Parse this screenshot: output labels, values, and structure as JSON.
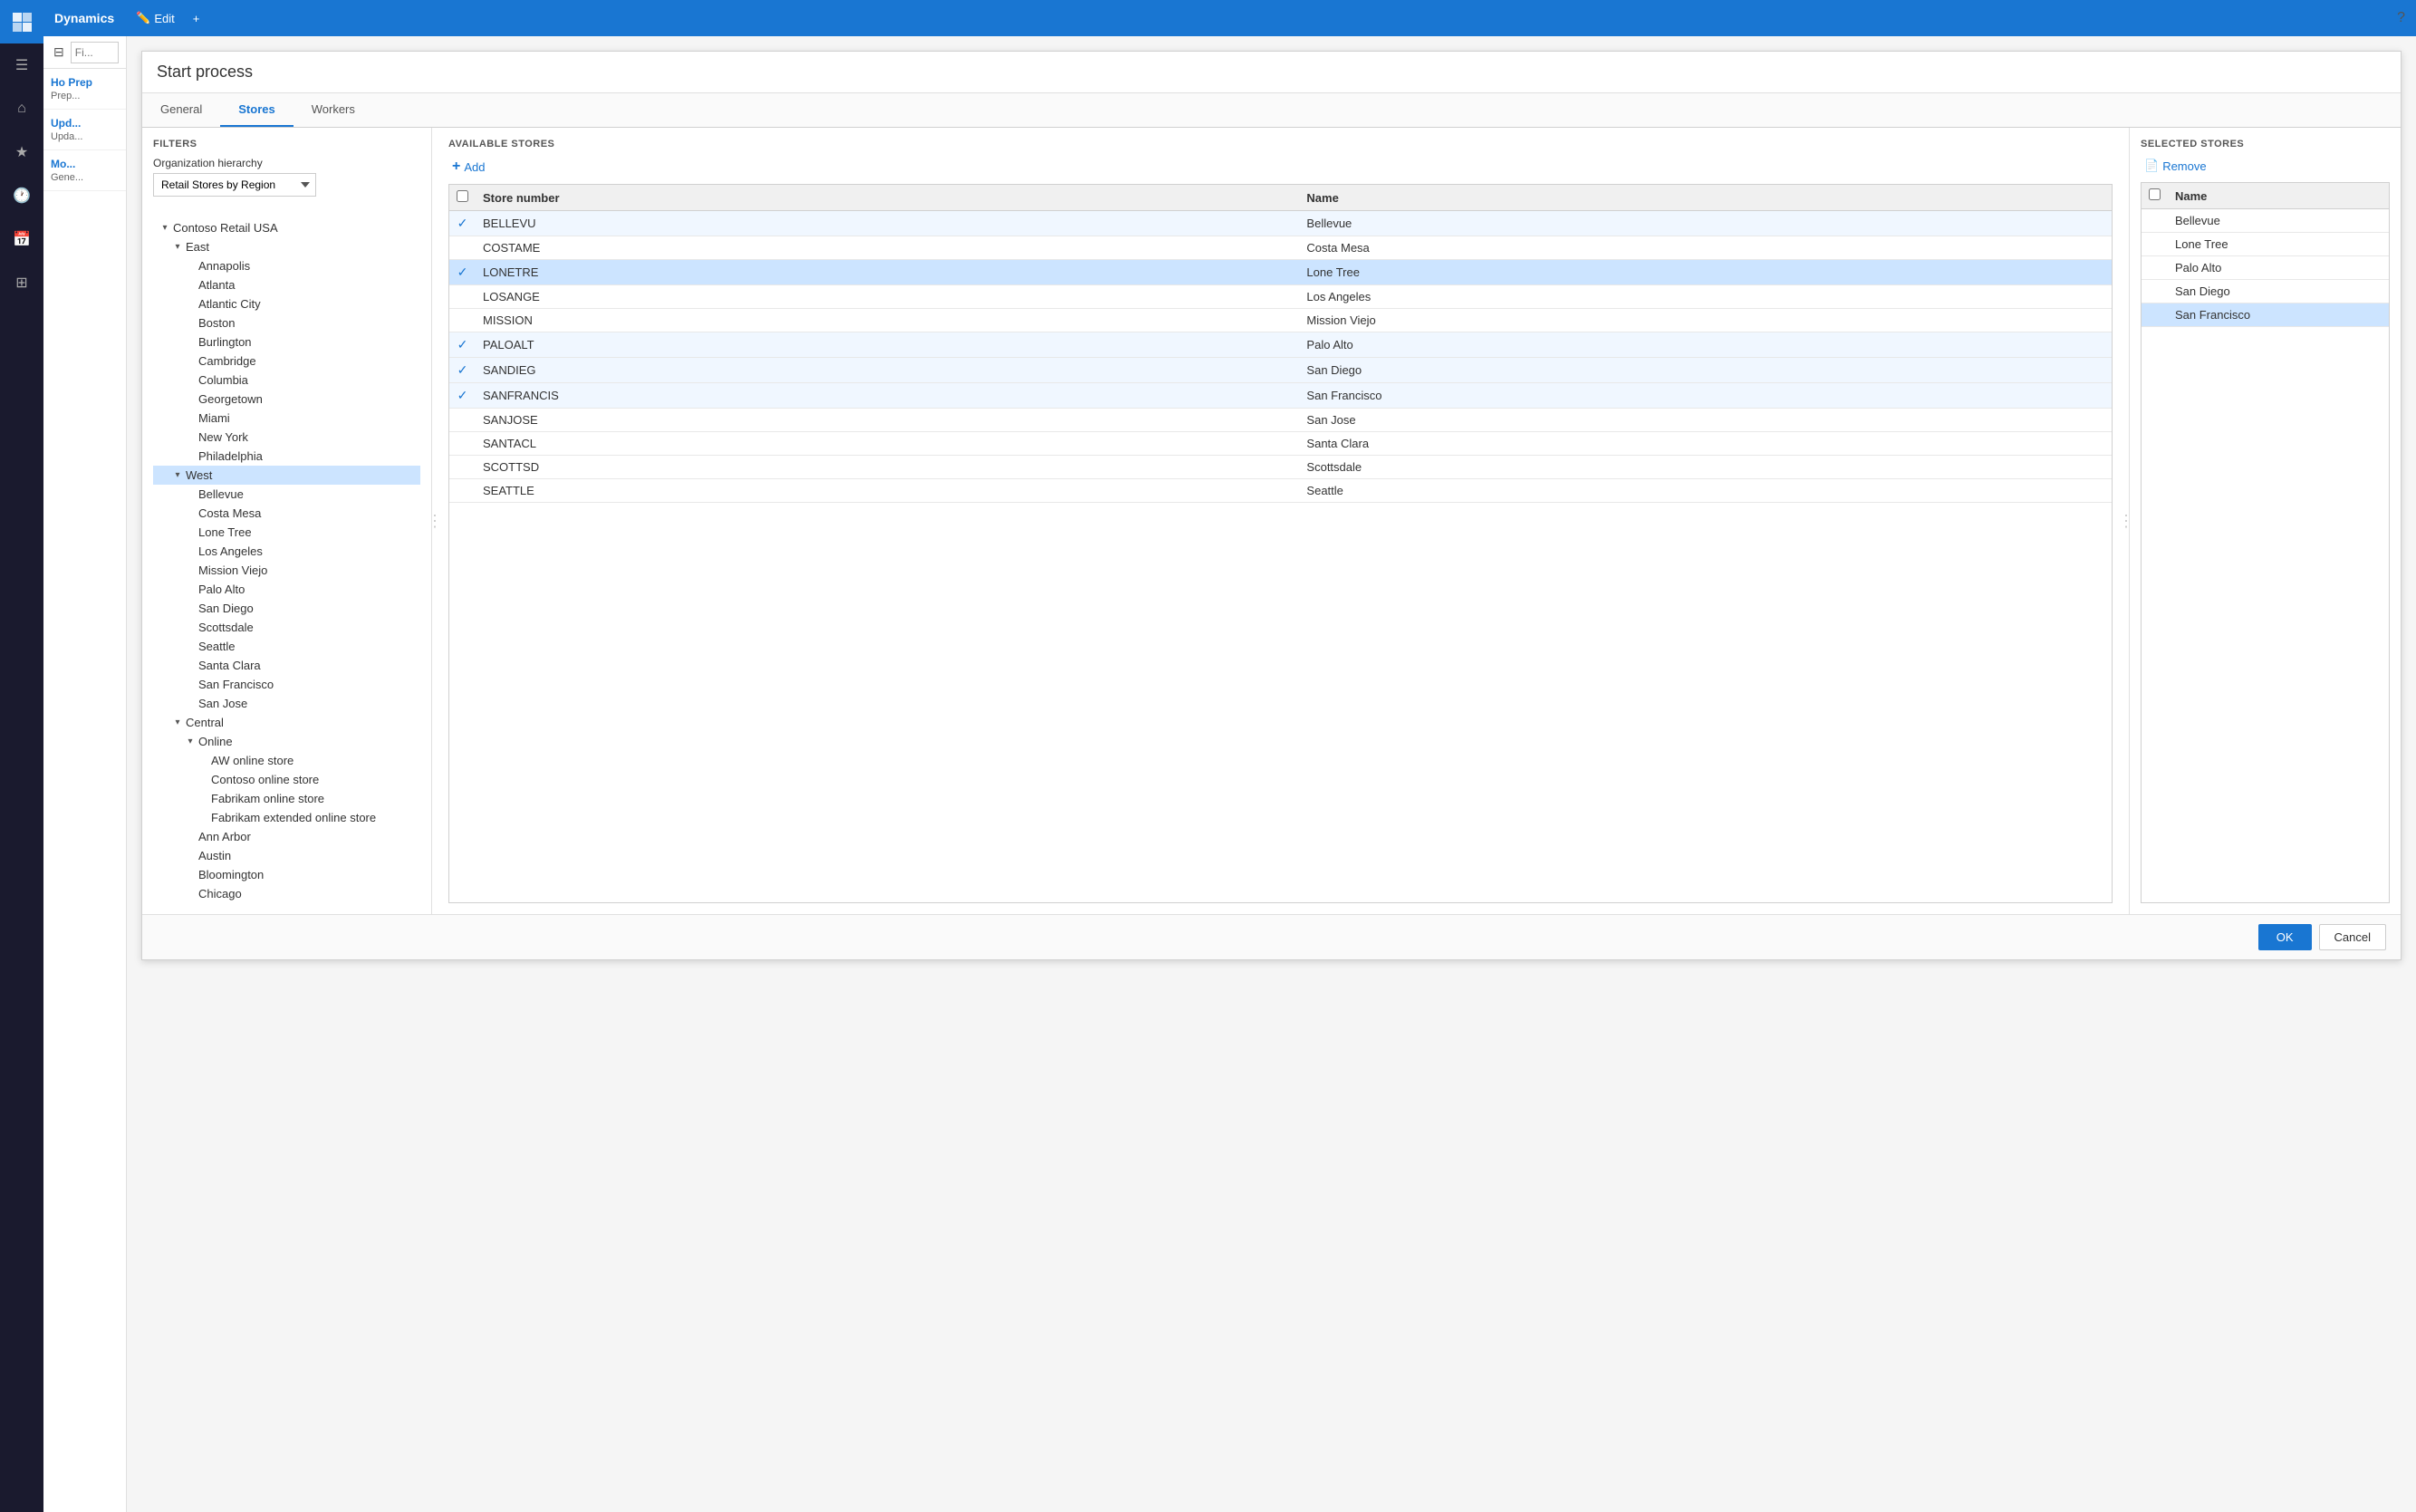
{
  "app": {
    "brand": "Dynamics",
    "help_icon": "?"
  },
  "topbar": {
    "edit_label": "Edit",
    "add_icon": "+",
    "nav_icons": [
      "☰",
      "⌂",
      "★",
      "🕐",
      "📅",
      "≡"
    ]
  },
  "left_panel": {
    "items": [
      {
        "title": "Ho Prep",
        "sub": "Prep..."
      },
      {
        "title": "Upd...",
        "sub": "Upda..."
      },
      {
        "title": "Mo...",
        "sub": "Gene..."
      }
    ]
  },
  "dialog": {
    "title": "Start process",
    "tabs": [
      {
        "label": "General",
        "active": false
      },
      {
        "label": "Stores",
        "active": true
      },
      {
        "label": "Workers",
        "active": false
      }
    ],
    "filters": {
      "section_title": "FILTERS",
      "org_hierarchy_label": "Organization hierarchy",
      "dropdown_value": "Retail Stores by Region",
      "dropdown_options": [
        "Retail Stores by Region"
      ],
      "tree": [
        {
          "id": "contoso",
          "label": "Contoso Retail USA",
          "indent": 0,
          "expandable": true,
          "expanded": true,
          "bold": false
        },
        {
          "id": "east",
          "label": "East",
          "indent": 1,
          "expandable": true,
          "expanded": true,
          "bold": false
        },
        {
          "id": "annapolis",
          "label": "Annapolis",
          "indent": 2,
          "expandable": false,
          "expanded": false,
          "bold": false
        },
        {
          "id": "atlanta",
          "label": "Atlanta",
          "indent": 2,
          "expandable": false,
          "expanded": false,
          "bold": false
        },
        {
          "id": "atlantic-city",
          "label": "Atlantic City",
          "indent": 2,
          "expandable": false,
          "expanded": false,
          "bold": false
        },
        {
          "id": "boston",
          "label": "Boston",
          "indent": 2,
          "expandable": false,
          "expanded": false,
          "bold": false
        },
        {
          "id": "burlington",
          "label": "Burlington",
          "indent": 2,
          "expandable": false,
          "expanded": false,
          "bold": false
        },
        {
          "id": "cambridge",
          "label": "Cambridge",
          "indent": 2,
          "expandable": false,
          "expanded": false,
          "bold": false
        },
        {
          "id": "columbia",
          "label": "Columbia",
          "indent": 2,
          "expandable": false,
          "expanded": false,
          "bold": false
        },
        {
          "id": "georgetown",
          "label": "Georgetown",
          "indent": 2,
          "expandable": false,
          "expanded": false,
          "bold": false
        },
        {
          "id": "miami",
          "label": "Miami",
          "indent": 2,
          "expandable": false,
          "expanded": false,
          "bold": false
        },
        {
          "id": "new-york",
          "label": "New York",
          "indent": 2,
          "expandable": false,
          "expanded": false,
          "bold": false
        },
        {
          "id": "philadelphia",
          "label": "Philadelphia",
          "indent": 2,
          "expandable": false,
          "expanded": false,
          "bold": false
        },
        {
          "id": "west",
          "label": "West",
          "indent": 1,
          "expandable": true,
          "expanded": true,
          "bold": false,
          "selected": true
        },
        {
          "id": "bellevue",
          "label": "Bellevue",
          "indent": 2,
          "expandable": false,
          "expanded": false,
          "bold": false
        },
        {
          "id": "costa-mesa",
          "label": "Costa Mesa",
          "indent": 2,
          "expandable": false,
          "expanded": false,
          "bold": false
        },
        {
          "id": "lone-tree",
          "label": "Lone Tree",
          "indent": 2,
          "expandable": false,
          "expanded": false,
          "bold": false
        },
        {
          "id": "los-angeles",
          "label": "Los Angeles",
          "indent": 2,
          "expandable": false,
          "expanded": false,
          "bold": false
        },
        {
          "id": "mission-viejo",
          "label": "Mission Viejo",
          "indent": 2,
          "expandable": false,
          "expanded": false,
          "bold": false
        },
        {
          "id": "palo-alto",
          "label": "Palo Alto",
          "indent": 2,
          "expandable": false,
          "expanded": false,
          "bold": false
        },
        {
          "id": "san-diego",
          "label": "San Diego",
          "indent": 2,
          "expandable": false,
          "expanded": false,
          "bold": false
        },
        {
          "id": "scottsdale",
          "label": "Scottsdale",
          "indent": 2,
          "expandable": false,
          "expanded": false,
          "bold": false
        },
        {
          "id": "seattle",
          "label": "Seattle",
          "indent": 2,
          "expandable": false,
          "expanded": false,
          "bold": false
        },
        {
          "id": "santa-clara",
          "label": "Santa Clara",
          "indent": 2,
          "expandable": false,
          "expanded": false,
          "bold": false
        },
        {
          "id": "san-francisco",
          "label": "San Francisco",
          "indent": 2,
          "expandable": false,
          "expanded": false,
          "bold": false
        },
        {
          "id": "san-jose",
          "label": "San Jose",
          "indent": 2,
          "expandable": false,
          "expanded": false,
          "bold": false
        },
        {
          "id": "central",
          "label": "Central",
          "indent": 1,
          "expandable": true,
          "expanded": true,
          "bold": false
        },
        {
          "id": "online",
          "label": "Online",
          "indent": 2,
          "expandable": true,
          "expanded": true,
          "bold": false
        },
        {
          "id": "aw-online",
          "label": "AW online store",
          "indent": 3,
          "expandable": false,
          "expanded": false,
          "bold": false
        },
        {
          "id": "contoso-online",
          "label": "Contoso online store",
          "indent": 3,
          "expandable": false,
          "expanded": false,
          "bold": false
        },
        {
          "id": "fabrikam-online",
          "label": "Fabrikam online store",
          "indent": 3,
          "expandable": false,
          "expanded": false,
          "bold": false
        },
        {
          "id": "fabrikam-extended",
          "label": "Fabrikam extended online store",
          "indent": 3,
          "expandable": false,
          "expanded": false,
          "bold": false
        },
        {
          "id": "ann-arbor",
          "label": "Ann Arbor",
          "indent": 2,
          "expandable": false,
          "expanded": false,
          "bold": false
        },
        {
          "id": "austin",
          "label": "Austin",
          "indent": 2,
          "expandable": false,
          "expanded": false,
          "bold": false
        },
        {
          "id": "bloomington",
          "label": "Bloomington",
          "indent": 2,
          "expandable": false,
          "expanded": false,
          "bold": false
        },
        {
          "id": "chicago",
          "label": "Chicago",
          "indent": 2,
          "expandable": false,
          "expanded": false,
          "bold": false
        }
      ]
    },
    "available_stores": {
      "section_title": "AVAILABLE STORES",
      "add_label": "Add",
      "columns": [
        "Store number",
        "Name"
      ],
      "rows": [
        {
          "store_number": "BELLEVU",
          "name": "Bellevue",
          "checked": true,
          "selected": false
        },
        {
          "store_number": "COSTAME",
          "name": "Costa Mesa",
          "checked": false,
          "selected": false
        },
        {
          "store_number": "LONETRE",
          "name": "Lone Tree",
          "checked": true,
          "selected": true
        },
        {
          "store_number": "LOSANGE",
          "name": "Los Angeles",
          "checked": false,
          "selected": false
        },
        {
          "store_number": "MISSION",
          "name": "Mission Viejo",
          "checked": false,
          "selected": false
        },
        {
          "store_number": "PALOALT",
          "name": "Palo Alto",
          "checked": true,
          "selected": false
        },
        {
          "store_number": "SANDIEG",
          "name": "San Diego",
          "checked": true,
          "selected": false
        },
        {
          "store_number": "SANFRANCIS",
          "name": "San Francisco",
          "checked": true,
          "selected": false
        },
        {
          "store_number": "SANJOSE",
          "name": "San Jose",
          "checked": false,
          "selected": false
        },
        {
          "store_number": "SANTACL",
          "name": "Santa Clara",
          "checked": false,
          "selected": false
        },
        {
          "store_number": "SCOTTSD",
          "name": "Scottsdale",
          "checked": false,
          "selected": false
        },
        {
          "store_number": "SEATTLE",
          "name": "Seattle",
          "checked": false,
          "selected": false
        }
      ]
    },
    "selected_stores": {
      "section_title": "SELECTED STORES",
      "remove_label": "Remove",
      "remove_icon": "📄",
      "columns": [
        "Name"
      ],
      "rows": [
        {
          "name": "Bellevue",
          "selected": false
        },
        {
          "name": "Lone Tree",
          "selected": false
        },
        {
          "name": "Palo Alto",
          "selected": false
        },
        {
          "name": "San Diego",
          "selected": false
        },
        {
          "name": "San Francisco",
          "selected": true
        }
      ]
    },
    "footer": {
      "ok_label": "OK",
      "cancel_label": "Cancel"
    }
  }
}
